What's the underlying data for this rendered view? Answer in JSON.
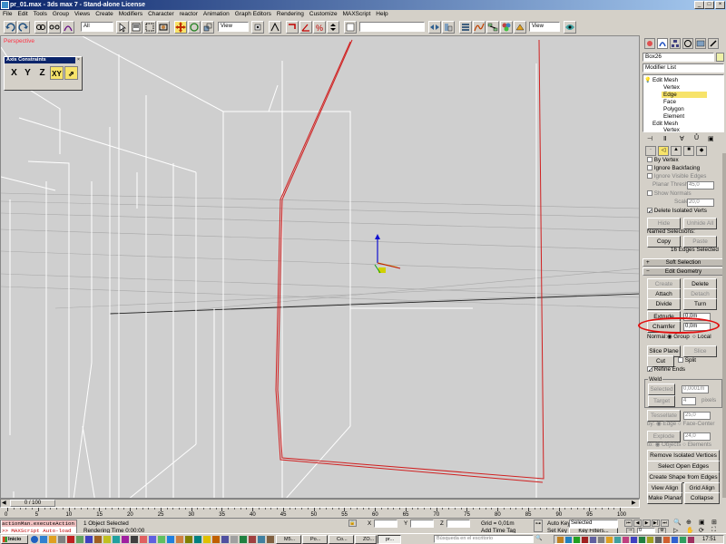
{
  "window": {
    "title": "pr_01.max - 3ds max 7 - Stand-alone License",
    "menu": [
      "File",
      "Edit",
      "Tools",
      "Group",
      "Views",
      "Create",
      "Modifiers",
      "Character",
      "reactor",
      "Animation",
      "Graph Editors",
      "Rendering",
      "Customize",
      "MAXScript",
      "Help"
    ]
  },
  "toolbar": {
    "selection_filter": "All",
    "ref_coord": "View",
    "ref_coord_2": "View",
    "named_selection": ""
  },
  "viewport": {
    "label": "Perspective",
    "axis_constraints": {
      "title": "Axis Constraints",
      "buttons": [
        "X",
        "Y",
        "Z",
        "XY"
      ]
    }
  },
  "command_panel": {
    "object_name": "Box26",
    "modifier_list": "Modifier List",
    "stack": [
      "Edit Mesh",
      "Vertex",
      "Edge",
      "Face",
      "Polygon",
      "Element",
      "Edit Mesh",
      "Vertex"
    ],
    "selected_stack_item": "Edge",
    "selection": {
      "by_vertex": "By Vertex",
      "ignore_backfacing": "Ignore Backfacing",
      "ignore_visible_edges": "Ignore Visible Edges",
      "planar_thresh_label": "Planar Thresh",
      "planar_thresh": "45,0",
      "show_normals": "Show Normals",
      "scale_label": "Scale",
      "scale": "20,0",
      "delete_isolated": "Delete Isolated Verts",
      "hide": "Hide",
      "unhide_all": "Unhide All",
      "named_selections": "Named Selections:",
      "copy": "Copy",
      "paste": "Paste",
      "status": "16 Edges Selected"
    },
    "rollouts": {
      "soft_selection": "Soft Selection",
      "edit_geometry": "Edit Geometry"
    },
    "edit_geometry": {
      "create": "Create",
      "delete": "Delete",
      "attach": "Attach",
      "detach": "Detach",
      "divide": "Divide",
      "turn": "Turn",
      "extrude": "Extrude",
      "extrude_value": "0,0m",
      "chamfer": "Chamfer",
      "chamfer_value": "0,0m",
      "normal": "Normal:",
      "group": "Group",
      "local": "Local",
      "slice_plane": "Slice Plane",
      "slice": "Slice",
      "cut": "Cut",
      "split": "Split",
      "refine_ends": "Refine Ends",
      "weld": "Weld",
      "selected": "Selected",
      "weld_value": "0,0001m",
      "target": "Target",
      "target_value": "4",
      "pixels": "pixels",
      "tessellate": "Tessellate",
      "tess_value": "25,0",
      "by": "by:",
      "edge": "Edge",
      "face_center": "Face-Center",
      "explode": "Explode",
      "explode_value": "24,0",
      "to": "to:",
      "objects": "Objects",
      "elements": "Elements",
      "remove_isolated": "Remove Isolated Vertices",
      "select_open_edges": "Select Open Edges",
      "create_shape": "Create Shape from Edges",
      "view_align": "View Align",
      "grid_align": "Grid Align",
      "make_planar": "Make Planar",
      "collapse": "Collapse"
    }
  },
  "timeline": {
    "slider": "0 / 100",
    "ticks": [
      "0",
      "5",
      "10",
      "15",
      "20",
      "25",
      "30",
      "35",
      "40",
      "45",
      "50",
      "55",
      "60",
      "65",
      "70",
      "75",
      "80",
      "85",
      "90",
      "95",
      "100"
    ]
  },
  "status": {
    "listener_1": "actionMan.executeAction",
    "listener_2": ">> MAXScript Auto-load",
    "selected": "1 Object Selected",
    "rendering_time": "Rendering Time  0:00:00",
    "x": "X",
    "y": "Y",
    "z": "Z",
    "grid": "Grid = 0,01m",
    "add_time_tag": "Add Time Tag",
    "auto_key": "Auto Key",
    "set_key": "Set Key",
    "key_selected": "Selected",
    "key_filters": "Key Filters...",
    "frame": "0"
  },
  "taskbar": {
    "start": "Inicio",
    "tasks": [
      "M5...",
      "Po...",
      "Co...",
      "ZO...",
      "pr..."
    ],
    "search": "Búsqueda en el escritorio",
    "clock": "17:51"
  }
}
